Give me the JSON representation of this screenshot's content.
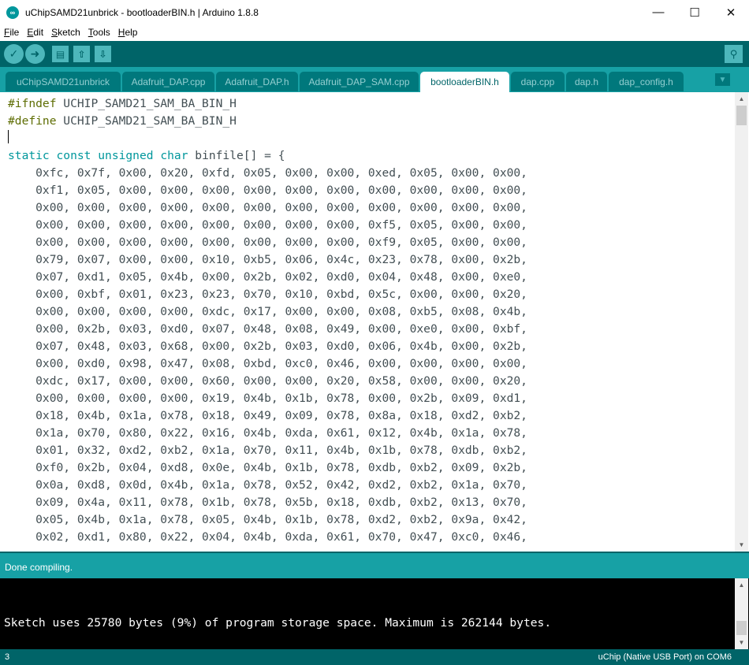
{
  "window": {
    "title": "uChipSAMD21unbrick - bootloaderBIN.h | Arduino 1.8.8",
    "icon": "arduino-logo-icon",
    "controls": [
      "minimize",
      "maximize",
      "close"
    ]
  },
  "menu": [
    {
      "label": "File",
      "hotkey": "F",
      "rest": "ile"
    },
    {
      "label": "Edit",
      "hotkey": "E",
      "rest": "dit"
    },
    {
      "label": "Sketch",
      "hotkey": "S",
      "rest": "ketch"
    },
    {
      "label": "Tools",
      "hotkey": "T",
      "rest": "ools"
    },
    {
      "label": "Help",
      "hotkey": "H",
      "rest": "elp"
    }
  ],
  "toolbar": {
    "buttons": [
      "verify",
      "upload",
      "new",
      "open",
      "save"
    ],
    "right_button": "serial-monitor"
  },
  "tabs": [
    {
      "label": "uChipSAMD21unbrick",
      "active": false
    },
    {
      "label": "Adafruit_DAP.cpp",
      "active": false
    },
    {
      "label": "Adafruit_DAP.h",
      "active": false
    },
    {
      "label": "Adafruit_DAP_SAM.cpp",
      "active": false
    },
    {
      "label": "bootloaderBIN.h",
      "active": true
    },
    {
      "label": "dap.cpp",
      "active": false
    },
    {
      "label": "dap.h",
      "active": false
    },
    {
      "label": "dap_config.h",
      "active": false
    }
  ],
  "editor": {
    "header": [
      {
        "kw": "#ifndef",
        "rest": " UCHIP_SAMD21_SAM_BA_BIN_H"
      },
      {
        "kw": "#define",
        "rest": " UCHIP_SAMD21_SAM_BA_BIN_H"
      }
    ],
    "declaration": {
      "kw1": "static",
      "kw2": "const",
      "kw3": "unsigned",
      "kw4": "char",
      "rest": " binfile[] = {"
    },
    "data_lines": [
      "    0xfc, 0x7f, 0x00, 0x20, 0xfd, 0x05, 0x00, 0x00, 0xed, 0x05, 0x00, 0x00,",
      "    0xf1, 0x05, 0x00, 0x00, 0x00, 0x00, 0x00, 0x00, 0x00, 0x00, 0x00, 0x00,",
      "    0x00, 0x00, 0x00, 0x00, 0x00, 0x00, 0x00, 0x00, 0x00, 0x00, 0x00, 0x00,",
      "    0x00, 0x00, 0x00, 0x00, 0x00, 0x00, 0x00, 0x00, 0xf5, 0x05, 0x00, 0x00,",
      "    0x00, 0x00, 0x00, 0x00, 0x00, 0x00, 0x00, 0x00, 0xf9, 0x05, 0x00, 0x00,",
      "    0x79, 0x07, 0x00, 0x00, 0x10, 0xb5, 0x06, 0x4c, 0x23, 0x78, 0x00, 0x2b,",
      "    0x07, 0xd1, 0x05, 0x4b, 0x00, 0x2b, 0x02, 0xd0, 0x04, 0x48, 0x00, 0xe0,",
      "    0x00, 0xbf, 0x01, 0x23, 0x23, 0x70, 0x10, 0xbd, 0x5c, 0x00, 0x00, 0x20,",
      "    0x00, 0x00, 0x00, 0x00, 0xdc, 0x17, 0x00, 0x00, 0x08, 0xb5, 0x08, 0x4b,",
      "    0x00, 0x2b, 0x03, 0xd0, 0x07, 0x48, 0x08, 0x49, 0x00, 0xe0, 0x00, 0xbf,",
      "    0x07, 0x48, 0x03, 0x68, 0x00, 0x2b, 0x03, 0xd0, 0x06, 0x4b, 0x00, 0x2b,",
      "    0x00, 0xd0, 0x98, 0x47, 0x08, 0xbd, 0xc0, 0x46, 0x00, 0x00, 0x00, 0x00,",
      "    0xdc, 0x17, 0x00, 0x00, 0x60, 0x00, 0x00, 0x20, 0x58, 0x00, 0x00, 0x20,",
      "    0x00, 0x00, 0x00, 0x00, 0x19, 0x4b, 0x1b, 0x78, 0x00, 0x2b, 0x09, 0xd1,",
      "    0x18, 0x4b, 0x1a, 0x78, 0x18, 0x49, 0x09, 0x78, 0x8a, 0x18, 0xd2, 0xb2,",
      "    0x1a, 0x70, 0x80, 0x22, 0x16, 0x4b, 0xda, 0x61, 0x12, 0x4b, 0x1a, 0x78,",
      "    0x01, 0x32, 0xd2, 0xb2, 0x1a, 0x70, 0x11, 0x4b, 0x1b, 0x78, 0xdb, 0xb2,",
      "    0xf0, 0x2b, 0x04, 0xd8, 0x0e, 0x4b, 0x1b, 0x78, 0xdb, 0xb2, 0x09, 0x2b,",
      "    0x0a, 0xd8, 0x0d, 0x4b, 0x1a, 0x78, 0x52, 0x42, 0xd2, 0xb2, 0x1a, 0x70,",
      "    0x09, 0x4a, 0x11, 0x78, 0x1b, 0x78, 0x5b, 0x18, 0xdb, 0xb2, 0x13, 0x70,",
      "    0x05, 0x4b, 0x1a, 0x78, 0x05, 0x4b, 0x1b, 0x78, 0xd2, 0xb2, 0x9a, 0x42,",
      "    0x02, 0xd1, 0x80, 0x22, 0x04, 0x4b, 0xda, 0x61, 0x70, 0x47, 0xc0, 0x46,"
    ]
  },
  "status": {
    "message": "Done compiling."
  },
  "console": {
    "output": "Sketch uses 25780 bytes (9%) of program storage space. Maximum is 262144 bytes."
  },
  "footer": {
    "line": "3",
    "board": "uChip (Native USB Port) on COM6"
  },
  "colors": {
    "toolbar": "#006468",
    "tabbar": "#17a1a5",
    "tab_inactive": "#00787c",
    "preprocessor": "#5e6d03",
    "keyword": "#00979c",
    "code_text": "#434f54"
  }
}
